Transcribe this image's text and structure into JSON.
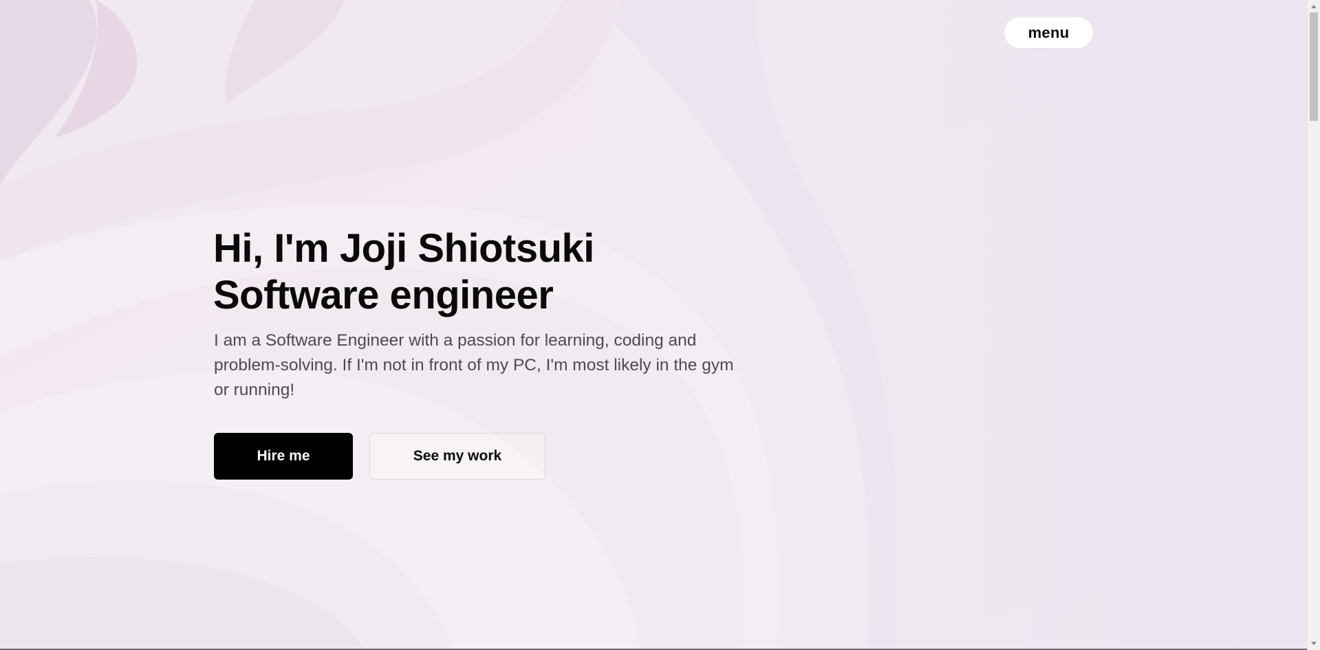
{
  "nav": {
    "menu_label": "menu"
  },
  "hero": {
    "title_line1": "Hi, I'm Joji Shiotsuki",
    "title_line2": "Software engineer",
    "description": "I am a Software Engineer with a passion for learning, coding and problem-solving. If I'm not in front of my PC, I'm most likely in the gym or running!"
  },
  "actions": {
    "primary_label": "Hire me",
    "secondary_label": "See my work"
  },
  "colors": {
    "primary_button_bg": "#000000",
    "primary_button_text": "#ffffff",
    "background_tint": "#efe8f0"
  }
}
